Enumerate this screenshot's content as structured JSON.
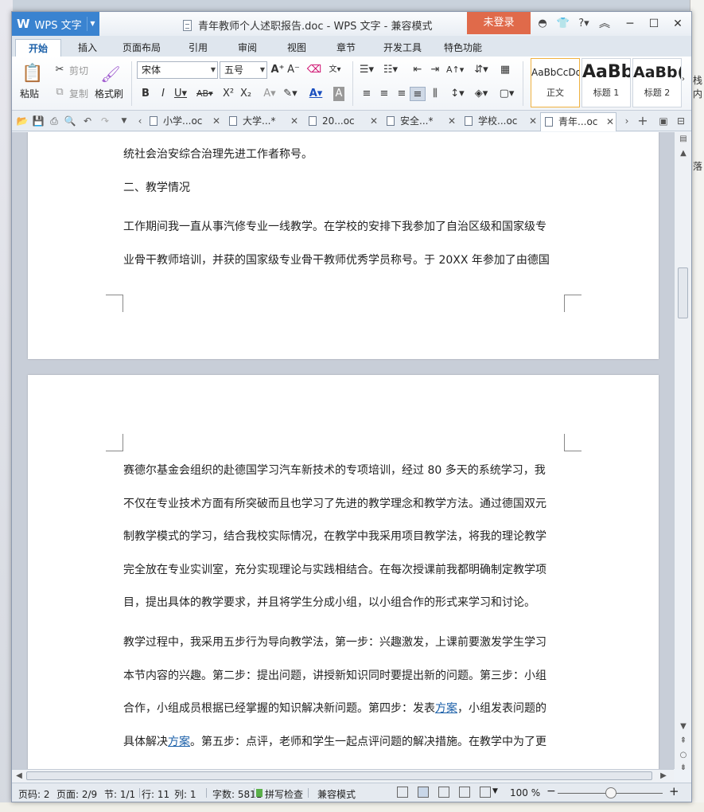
{
  "app": {
    "logo": "W",
    "name": "WPS 文字",
    "title": "青年教师个人述职报告.doc - WPS 文字 - 兼容模式",
    "login": "未登录"
  },
  "tabs": [
    "开始",
    "插入",
    "页面布局",
    "引用",
    "审阅",
    "视图",
    "章节",
    "开发工具",
    "特色功能"
  ],
  "ribbon": {
    "paste": "粘贴",
    "cut": "剪切",
    "copy": "复制",
    "format_painter": "格式刷",
    "font_name": "宋体",
    "font_size": "五号",
    "styles": [
      {
        "preview": "AaBbCcDd",
        "name": "正文"
      },
      {
        "preview": "AaBb",
        "name": "标题 1"
      },
      {
        "preview": "AaBb(",
        "name": "标题 2"
      }
    ]
  },
  "doc_tabs": [
    "小学...oc",
    "大学...*",
    "20...oc",
    "安全...*",
    "学校...oc",
    "青年...oc"
  ],
  "page1": {
    "lines": [
      "统社会治安综合治理先进工作者称号。",
      "二、教学情况",
      "工作期间我一直从事汽修专业一线教学。在学校的安排下我参加了自治区级和国家级专",
      "业骨干教师培训，并获的国家级专业骨干教师优秀学员称号。于 20XX 年参加了由德国"
    ]
  },
  "page2": {
    "para1": [
      "赛德尔基金会组织的赴德国学习汽车新技术的专项培训，经过 80 多天的系统学习，我",
      "不仅在专业技术方面有所突破而且也学习了先进的教学理念和教学方法。通过德国双元",
      "制教学模式的学习，结合我校实际情况，在教学中我采用项目教学法，将我的理论教学",
      "完全放在专业实训室，充分实现理论与实践相结合。在每次授课前我都明确制定教学项",
      "目，提出具体的教学要求，并且将学生分成小组，以小组合作的形式来学习和讨论。"
    ],
    "para2": [
      "教学过程中，我采用五步行为导向教学法，第一步：兴趣激发，上课前要激发学生学习",
      "本节内容的兴趣。第二步：提出问题，讲授新知识同时要提出新的问题。第三步：小组",
      "合作，小组成员根据已经掌握的知识解决新问题。第四步：发表",
      "方案",
      "，小组发表问题的",
      "具体解决",
      "方案",
      "。第五步：点评，老师和学生一起点评问题的解决措施。在教学中为了更"
    ]
  },
  "status": {
    "page_code": "页码: 2",
    "pages": "页面: 2/9",
    "section": "节: 1/1",
    "row": "行: 11",
    "col": "列: 1",
    "words": "字数: 5811",
    "spell": "拼写检查",
    "compat": "兼容模式",
    "zoom": "100 %"
  },
  "bg_right_chars": [
    "栈内",
    "落"
  ]
}
